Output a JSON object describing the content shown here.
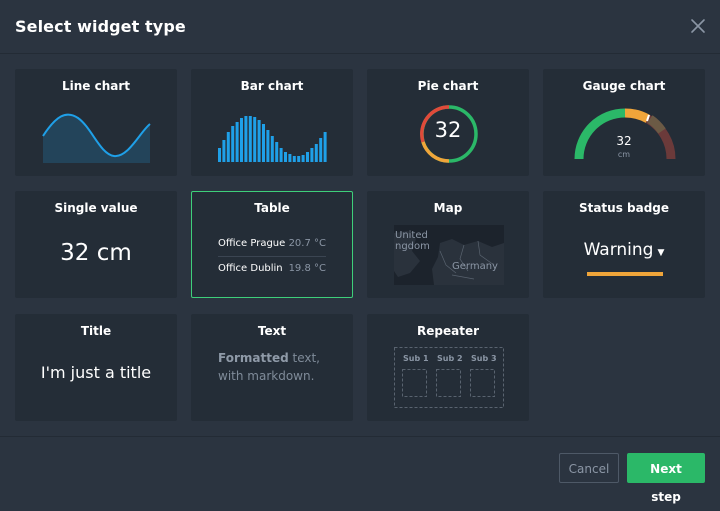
{
  "dialog": {
    "title": "Select widget type",
    "close_icon": "close-icon"
  },
  "widgets": {
    "line_chart": {
      "label": "Line chart"
    },
    "bar_chart": {
      "label": "Bar chart"
    },
    "pie_chart": {
      "label": "Pie chart",
      "value": "32"
    },
    "gauge_chart": {
      "label": "Gauge chart",
      "value": "32",
      "unit": "cm"
    },
    "single_value": {
      "label": "Single value",
      "value": "32 cm"
    },
    "table": {
      "label": "Table",
      "rows": [
        {
          "name": "Office Prague",
          "value": "20.7 °C"
        },
        {
          "name": "Office Dublin",
          "value": "19.8 °C"
        }
      ]
    },
    "map": {
      "label": "Map",
      "place_1": "United Kingdom",
      "place_1_visible": "United\nngdom",
      "place_2": "Germany"
    },
    "status_badge": {
      "label": "Status badge",
      "value": "Warning"
    },
    "title_widget": {
      "label": "Title",
      "value": "I'm just a title"
    },
    "text_widget": {
      "label": "Text",
      "bold": "Formatted",
      "rest": " text,",
      "line2": "with markdown."
    },
    "repeater": {
      "label": "Repeater",
      "subs": [
        "Sub 1",
        "Sub 2",
        "Sub 3"
      ]
    }
  },
  "selected_widget": "Table",
  "footer": {
    "cancel_label": "Cancel",
    "next_label": "Next step"
  },
  "colors": {
    "accent_green": "#2bb868",
    "chart_blue": "#1fa0e8",
    "warning_orange": "#f0a53a",
    "pie_red": "#e04a3a",
    "gauge_green": "#2bb868",
    "gauge_brown": "#6b4a3a"
  }
}
